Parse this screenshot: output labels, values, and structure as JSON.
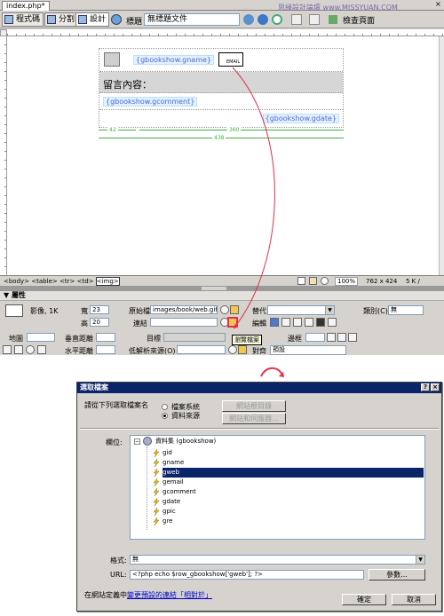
{
  "document_tab": {
    "filename": "index.php*"
  },
  "watermark": "思緣設計論壇 www.MISSYUAN.COM",
  "toolbar": {
    "code_label": "程式碼",
    "split_label": "分割",
    "design_label": "設計",
    "title_label": "標題",
    "title_value": "無標題文件",
    "check_page_label": "檢查頁面"
  },
  "design": {
    "name_tag": "{gbookshow.gname}",
    "image_alt": "EMAIL",
    "comment_header": "留言內容：",
    "comment_tag": "{gbookshow.gcomment}",
    "date_tag": "{gbookshow.gdate}",
    "measure_left": "42",
    "measure_right": "360",
    "measure_total": "438"
  },
  "statusbar": {
    "breadcrumb": [
      "<body>",
      "<table>",
      "<tr>",
      "<td>",
      "<img>"
    ],
    "zoom": "100%",
    "dimensions": "762 x 424",
    "size": "5 K /"
  },
  "properties": {
    "panel_title": "屬性",
    "image_label": "影像, 1K",
    "width_label": "寬",
    "width_value": "23",
    "height_label": "高",
    "height_value": "20",
    "src_label": "原始檔",
    "src_value": "images/book/web.gif",
    "link_label": "連結",
    "link_value": "",
    "alt_label": "替代",
    "class_label": "類別(C)",
    "class_value": "無",
    "edit_label": "編輯",
    "map_label": "地圖",
    "vspace_label": "垂直距離",
    "target_label": "目標",
    "border_label": "邊框",
    "hspace_label": "水平距離",
    "lowsrc_label": "低解析來源(O)",
    "align_label": "對齊",
    "align_value": "預設",
    "tooltip": "瀏覽檔案"
  },
  "dialog": {
    "title": "選取檔案",
    "prompt": "請從下列選取檔案名",
    "radio_filesystem": "檔案系統",
    "radio_datasource": "資料來源",
    "site_root_button": "網站根目錄",
    "server_button": "網站和伺服器...",
    "field_label": "欄位:",
    "tree_root": "資料集 (gbookshow)",
    "fields": [
      "gid",
      "gname",
      "gweb",
      "gemail",
      "gcomment",
      "gdate",
      "gpic",
      "gre"
    ],
    "selected_field": "gweb",
    "format_label": "格式:",
    "format_value": "無",
    "url_label": "URL:",
    "url_value": "<?php echo $row_gbookshow['gweb']; ?>",
    "params_button": "參數...",
    "footer_text": "在網站定義中",
    "footer_link": "變更預設的連結「相對於」",
    "ok_button": "確定",
    "cancel_button": "取消"
  },
  "colors": {
    "dialog_title_bar": "#0a246a",
    "connector_arrow": "#e0304e",
    "tag_text": "#5b5ed6",
    "measure_green": "#3cb043"
  }
}
